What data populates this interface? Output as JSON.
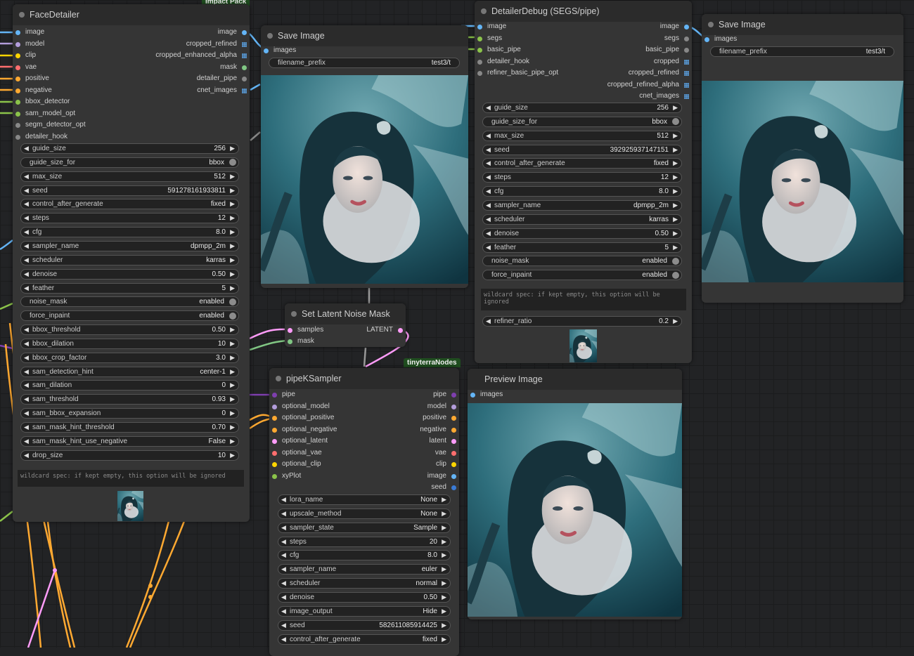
{
  "face_detailer": {
    "title": "FaceDetailer",
    "badge": "Impact Pack",
    "inputs": [
      {
        "label": "image",
        "color": "#64b5f6"
      },
      {
        "label": "model",
        "color": "#b39ddb"
      },
      {
        "label": "clip",
        "color": "#ffd500"
      },
      {
        "label": "vae",
        "color": "#ff6e6e"
      },
      {
        "label": "positive",
        "color": "#ffa931"
      },
      {
        "label": "negative",
        "color": "#ffa931"
      },
      {
        "label": "bbox_detector",
        "color": "#8bc34a"
      },
      {
        "label": "sam_model_opt",
        "color": "#8bc34a"
      },
      {
        "label": "segm_detector_opt",
        "color": "#888888"
      },
      {
        "label": "detailer_hook",
        "color": "#888888"
      }
    ],
    "outputs": [
      {
        "label": "image",
        "color": "#64b5f6"
      },
      {
        "label": "cropped_refined",
        "color": "#64b5f6",
        "grid": true
      },
      {
        "label": "cropped_enhanced_alpha",
        "color": "#64b5f6",
        "grid": true
      },
      {
        "label": "mask",
        "color": "#81c784"
      },
      {
        "label": "detailer_pipe",
        "color": "#888888"
      },
      {
        "label": "cnet_images",
        "color": "#64b5f6",
        "grid": true
      }
    ],
    "widgets": [
      {
        "label": "guide_size",
        "value": "256"
      },
      {
        "label": "guide_size_for",
        "value": "bbox",
        "toggle": true
      },
      {
        "label": "max_size",
        "value": "512"
      },
      {
        "label": "seed",
        "value": "591278161933811"
      },
      {
        "label": "control_after_generate",
        "value": "fixed"
      },
      {
        "label": "steps",
        "value": "12"
      },
      {
        "label": "cfg",
        "value": "8.0"
      },
      {
        "label": "sampler_name",
        "value": "dpmpp_2m"
      },
      {
        "label": "scheduler",
        "value": "karras"
      },
      {
        "label": "denoise",
        "value": "0.50"
      },
      {
        "label": "feather",
        "value": "5"
      },
      {
        "label": "noise_mask",
        "value": "enabled",
        "toggle": true
      },
      {
        "label": "force_inpaint",
        "value": "enabled",
        "toggle": true
      },
      {
        "label": "bbox_threshold",
        "value": "0.50"
      },
      {
        "label": "bbox_dilation",
        "value": "10"
      },
      {
        "label": "bbox_crop_factor",
        "value": "3.0"
      },
      {
        "label": "sam_detection_hint",
        "value": "center-1"
      },
      {
        "label": "sam_dilation",
        "value": "0"
      },
      {
        "label": "sam_threshold",
        "value": "0.93"
      },
      {
        "label": "sam_bbox_expansion",
        "value": "0"
      },
      {
        "label": "sam_mask_hint_threshold",
        "value": "0.70"
      },
      {
        "label": "sam_mask_hint_use_negative",
        "value": "False"
      },
      {
        "label": "drop_size",
        "value": "10"
      }
    ],
    "wildcard": "wildcard spec: if kept empty, this option will be ignored"
  },
  "save_image_1": {
    "title": "Save Image",
    "input": "images",
    "prefix_label": "filename_prefix",
    "prefix_value": "test3/t"
  },
  "latent_noise": {
    "title": "Set Latent Noise Mask",
    "inputs": [
      "samples",
      "mask"
    ],
    "output": "LATENT"
  },
  "detailer_debug": {
    "title": "DetailerDebug (SEGS/pipe)",
    "inputs": [
      {
        "label": "image",
        "color": "#64b5f6"
      },
      {
        "label": "segs",
        "color": "#8bc34a"
      },
      {
        "label": "basic_pipe",
        "color": "#8bc34a"
      },
      {
        "label": "detailer_hook",
        "color": "#888888"
      },
      {
        "label": "refiner_basic_pipe_opt",
        "color": "#888888"
      }
    ],
    "outputs": [
      {
        "label": "image",
        "color": "#64b5f6"
      },
      {
        "label": "segs",
        "color": "#888888"
      },
      {
        "label": "basic_pipe",
        "color": "#888888"
      },
      {
        "label": "cropped",
        "color": "#64b5f6",
        "grid": true
      },
      {
        "label": "cropped_refined",
        "color": "#64b5f6",
        "grid": true
      },
      {
        "label": "cropped_refined_alpha",
        "color": "#64b5f6",
        "grid": true
      },
      {
        "label": "cnet_images",
        "color": "#64b5f6",
        "grid": true
      }
    ],
    "widgets": [
      {
        "label": "guide_size",
        "value": "256"
      },
      {
        "label": "guide_size_for",
        "value": "bbox",
        "toggle": true
      },
      {
        "label": "max_size",
        "value": "512"
      },
      {
        "label": "seed",
        "value": "392925937147151"
      },
      {
        "label": "control_after_generate",
        "value": "fixed"
      },
      {
        "label": "steps",
        "value": "12"
      },
      {
        "label": "cfg",
        "value": "8.0"
      },
      {
        "label": "sampler_name",
        "value": "dpmpp_2m"
      },
      {
        "label": "scheduler",
        "value": "karras"
      },
      {
        "label": "denoise",
        "value": "0.50"
      },
      {
        "label": "feather",
        "value": "5"
      },
      {
        "label": "noise_mask",
        "value": "enabled",
        "toggle": true
      },
      {
        "label": "force_inpaint",
        "value": "enabled",
        "toggle": true
      }
    ],
    "wildcard": "wildcard spec: if kept empty, this option will be ignored",
    "refiner": {
      "label": "refiner_ratio",
      "value": "0.2"
    }
  },
  "save_image_2": {
    "title": "Save Image",
    "input": "images",
    "prefix_label": "filename_prefix",
    "prefix_value": "test3/t"
  },
  "pipe_ksampler": {
    "title": "pipeKSampler",
    "badge": "tinyterraNodes",
    "inputs": [
      {
        "label": "pipe",
        "color": "#7e3fae"
      },
      {
        "label": "optional_model",
        "color": "#b39ddb"
      },
      {
        "label": "optional_positive",
        "color": "#ffa931"
      },
      {
        "label": "optional_negative",
        "color": "#ffa931"
      },
      {
        "label": "optional_latent",
        "color": "#ff9cf9"
      },
      {
        "label": "optional_vae",
        "color": "#ff6e6e"
      },
      {
        "label": "optional_clip",
        "color": "#ffd500"
      },
      {
        "label": "xyPlot",
        "color": "#8bc34a"
      }
    ],
    "outputs": [
      {
        "label": "pipe",
        "color": "#7e3fae"
      },
      {
        "label": "model",
        "color": "#b39ddb"
      },
      {
        "label": "positive",
        "color": "#ffa931"
      },
      {
        "label": "negative",
        "color": "#ffa931"
      },
      {
        "label": "latent",
        "color": "#ff9cf9"
      },
      {
        "label": "vae",
        "color": "#ff6e6e"
      },
      {
        "label": "clip",
        "color": "#ffd500"
      },
      {
        "label": "image",
        "color": "#64b5f6"
      },
      {
        "label": "seed",
        "color": "#3a7bd5"
      }
    ],
    "widgets": [
      {
        "label": "lora_name",
        "value": "None"
      },
      {
        "label": "upscale_method",
        "value": "None"
      },
      {
        "label": "sampler_state",
        "value": "Sample"
      },
      {
        "label": "steps",
        "value": "20"
      },
      {
        "label": "cfg",
        "value": "8.0"
      },
      {
        "label": "sampler_name",
        "value": "euler"
      },
      {
        "label": "scheduler",
        "value": "normal"
      },
      {
        "label": "denoise",
        "value": "0.50"
      },
      {
        "label": "image_output",
        "value": "Hide"
      },
      {
        "label": "seed",
        "value": "582611085914425"
      },
      {
        "label": "control_after_generate",
        "value": "fixed"
      }
    ]
  },
  "preview_image": {
    "title": "Preview Image",
    "input": "images"
  }
}
